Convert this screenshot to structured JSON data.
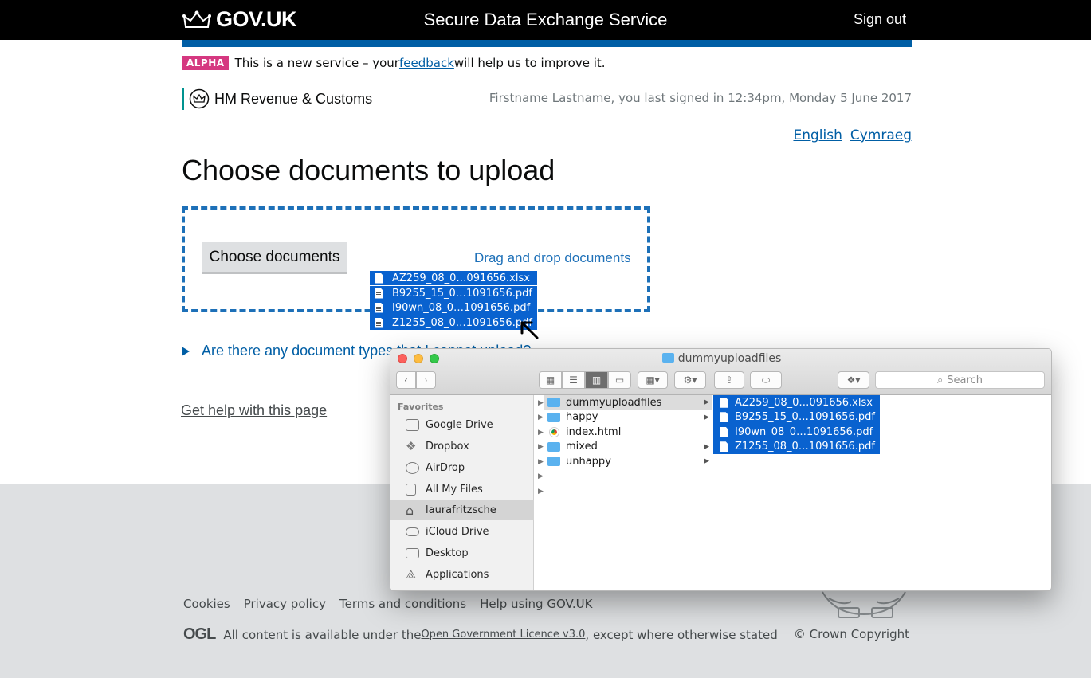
{
  "header": {
    "logo_text": "GOV.UK",
    "service_name": "Secure Data Exchange Service",
    "sign_out": "Sign out"
  },
  "phase": {
    "tag": "ALPHA",
    "text_before": "This is a new service – your ",
    "link": "feedback",
    "text_after": " will help us to improve it."
  },
  "org": {
    "name": "HM Revenue & Customs",
    "last_signed": "Firstname Lastname, you last signed in 12:34pm, Monday 5 June 2017"
  },
  "languages": [
    "English",
    "Cymraeg"
  ],
  "page_title": "Choose documents to upload",
  "upload": {
    "choose_button": "Choose documents",
    "drag_drop": "Drag and drop documents"
  },
  "dragged_files": [
    "AZ259_08_0…091656.xlsx",
    "B9255_15_0…1091656.pdf",
    "I90wn_08_0…1091656.pdf",
    "Z1255_08_0…1091656.pdf"
  ],
  "details_summary": "Are there any document types that I cannot upload?",
  "get_help": "Get help with this page",
  "footer": {
    "links": [
      "Cookies",
      "Privacy policy",
      "Terms and conditions",
      "Help using GOV.UK"
    ],
    "ogl_mark": "OGL",
    "licence_before": "All content is available under the ",
    "licence_link": "Open Government Licence v3.0",
    "licence_after": ", except where otherwise stated",
    "copyright": "© Crown Copyright"
  },
  "finder": {
    "title": "dummyuploadfiles",
    "search_placeholder": "Search",
    "favorites_label": "Favorites",
    "sidebar": [
      "Google Drive",
      "Dropbox",
      "AirDrop",
      "All My Files",
      "laurafritzsche",
      "iCloud Drive",
      "Desktop",
      "Applications"
    ],
    "column2": [
      "dummyuploadfiles",
      "happy",
      "index.html",
      "mixed",
      "unhappy"
    ],
    "column3": [
      "AZ259_08_0…091656.xlsx",
      "B9255_15_0…1091656.pdf",
      "I90wn_08_0…1091656.pdf",
      "Z1255_08_0…1091656.pdf"
    ]
  },
  "colors": {
    "govuk_blue": "#005ea5",
    "alpha_pink": "#d53880",
    "selection_blue": "#0962cf"
  }
}
